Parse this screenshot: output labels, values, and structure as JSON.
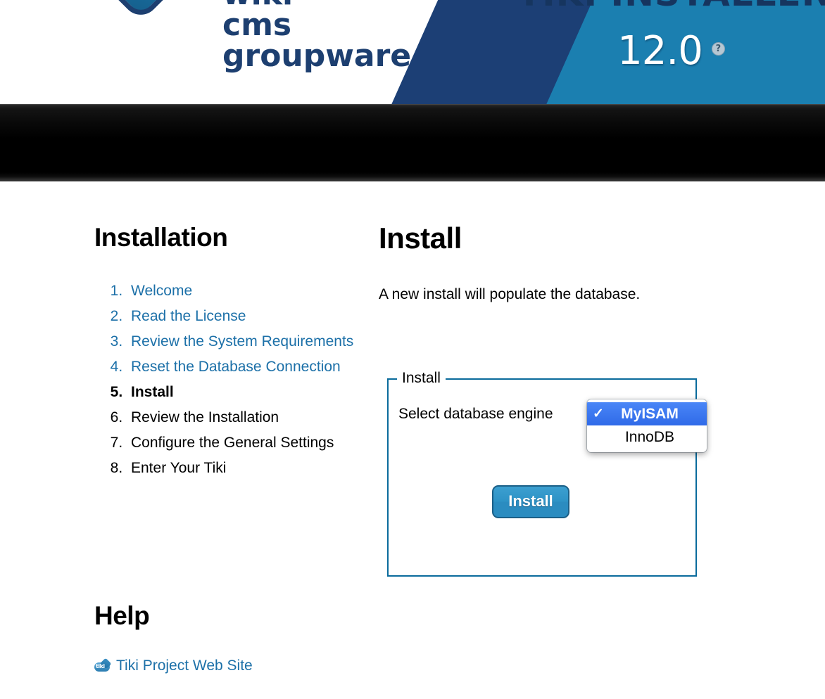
{
  "header": {
    "logo_words": [
      "wiki",
      "cms",
      "groupware"
    ],
    "installer_title": "TIKI INSTALLER",
    "version": "12.0",
    "version_help_icon": "question-mark-circle-icon",
    "logo_icon": "tiki-swoosh-logo-icon"
  },
  "navbar": {
    "items": []
  },
  "sidebar": {
    "heading": "Installation",
    "steps": [
      {
        "label": "Welcome",
        "state": "link"
      },
      {
        "label": "Read the License",
        "state": "link"
      },
      {
        "label": "Review the System Requirements",
        "state": "link"
      },
      {
        "label": "Reset the Database Connection",
        "state": "link"
      },
      {
        "label": "Install",
        "state": "current"
      },
      {
        "label": "Review the Installation",
        "state": "plain"
      },
      {
        "label": "Configure the General Settings",
        "state": "plain"
      },
      {
        "label": "Enter Your Tiki",
        "state": "plain"
      }
    ],
    "help_heading": "Help",
    "help_links": [
      {
        "label": "Tiki Project Web Site",
        "icon": "tiki-favicon-icon"
      }
    ]
  },
  "main": {
    "heading": "Install",
    "intro": "A new install will populate the database.",
    "fieldset": {
      "legend": "Install",
      "engine_label": "Select database engine",
      "engine_options": [
        {
          "label": "MyISAM",
          "selected": true
        },
        {
          "label": "InnoDB",
          "selected": false
        }
      ],
      "check_glyph": "✓",
      "submit_label": "Install"
    }
  },
  "colors": {
    "brand_blue": "#1b7fb0",
    "brand_navy": "#1c3f75",
    "link_blue": "#1c70a8",
    "fieldset_border": "#0a6b9c",
    "button_blue": "#2b8cc0",
    "select_highlight": "#2f6ae8",
    "navbar_black": "#000000"
  }
}
